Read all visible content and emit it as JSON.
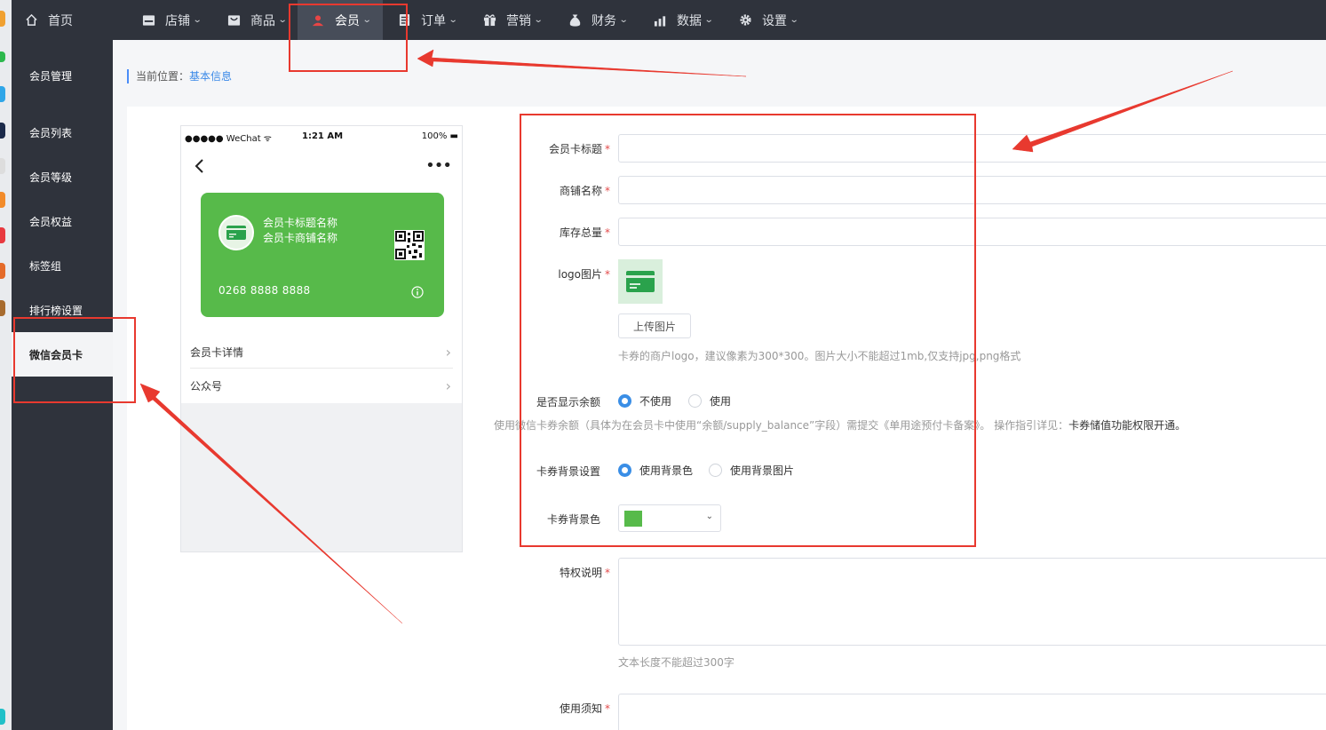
{
  "topnav": {
    "items": [
      {
        "label": "首页",
        "icon": "home-icon"
      },
      {
        "label": "店铺",
        "icon": "store-icon"
      },
      {
        "label": "商品",
        "icon": "goods-icon"
      },
      {
        "label": "会员",
        "icon": "user-icon",
        "active": true
      },
      {
        "label": "订单",
        "icon": "order-icon"
      },
      {
        "label": "营销",
        "icon": "gift-icon"
      },
      {
        "label": "财务",
        "icon": "money-bag-icon"
      },
      {
        "label": "数据",
        "icon": "bar-chart-icon"
      },
      {
        "label": "设置",
        "icon": "gear-icon"
      }
    ]
  },
  "sidebar": {
    "items": [
      {
        "label": "会员管理"
      },
      {
        "label": "会员列表"
      },
      {
        "label": "会员等级"
      },
      {
        "label": "会员权益"
      },
      {
        "label": "标签组"
      },
      {
        "label": "排行榜设置"
      },
      {
        "label": "微信会员卡",
        "active": true
      }
    ]
  },
  "breadcrumb": {
    "prefix": "当前位置：",
    "current": "基本信息"
  },
  "phone": {
    "status_left": "●●●●● WeChat ᯤ",
    "status_time": "1:21 AM",
    "status_right": "100% ▬",
    "card_title": "会员卡标题名称",
    "card_shop": "会员卡商铺名称",
    "card_number": "0268 8888 8888",
    "card_color": "#57ba4a",
    "rows": [
      {
        "label": "会员卡详情"
      },
      {
        "label": "公众号"
      }
    ]
  },
  "form": {
    "card_title_label": "会员卡标题",
    "shop_name_label": "商铺名称",
    "stock_label": "库存总量",
    "logo_label": "logo图片",
    "upload_label": "上传图片",
    "logo_hint": "卡券的商户logo，建议像素为300*300。图片大小不能超过1mb,仅支持jpg,png格式",
    "balance_label": "是否显示余额",
    "balance_options": [
      "不使用",
      "使用"
    ],
    "balance_selected": "不使用",
    "balance_hint": "使用微信卡券余额（具体为在会员卡中使用“余额/supply_balance”字段）需提交《单用途预付卡备案》。 操作指引详见：",
    "balance_hint_link": "卡券储值功能权限开通。",
    "bg_setting_label": "卡券背景设置",
    "bg_options": [
      "使用背景色",
      "使用背景图片"
    ],
    "bg_selected": "使用背景色",
    "bg_color_label": "卡券背景色",
    "bg_color": "#57ba4a",
    "privilege_label": "特权说明",
    "privilege_hint": "文本长度不能超过300字",
    "notice_label": "使用须知",
    "required_mark": "*"
  },
  "annotation_color": "#e8392f"
}
